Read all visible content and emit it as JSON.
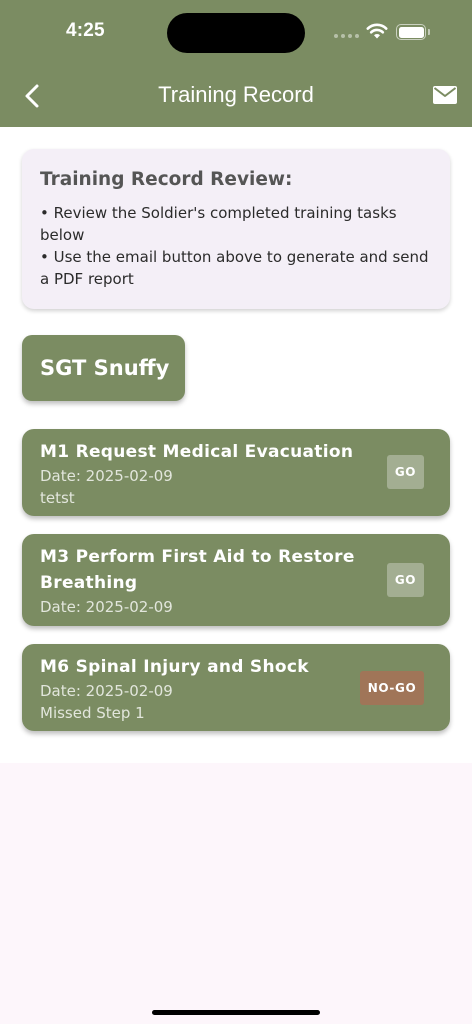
{
  "status_bar": {
    "time": "4:25"
  },
  "nav": {
    "title": "Training Record",
    "back_icon": "chevron-left-icon",
    "mail_icon": "mail-icon"
  },
  "info": {
    "title": "Training Record Review:",
    "lines": [
      "• Review the Soldier's completed training tasks below",
      "• Use the email button above to generate and send a PDF report"
    ]
  },
  "soldier": {
    "name": "SGT Snuffy"
  },
  "tasks": [
    {
      "title": "M1 Request Medical Evacuation",
      "date": "Date: 2025-02-09",
      "note": "tetst",
      "status": "GO"
    },
    {
      "title": "M3 Perform First Aid to Restore Breathing",
      "date": "Date: 2025-02-09",
      "note": "",
      "status": "GO"
    },
    {
      "title": "M6 Spinal Injury and Shock",
      "date": "Date: 2025-02-09",
      "note": "Missed Step 1",
      "status": "NO-GO"
    }
  ],
  "colors": {
    "header": "#7b8c62",
    "card": "#7b8c62",
    "go_badge": "#a3ae92",
    "nogo_badge": "#a07558",
    "info_bg": "#f4eff7"
  }
}
